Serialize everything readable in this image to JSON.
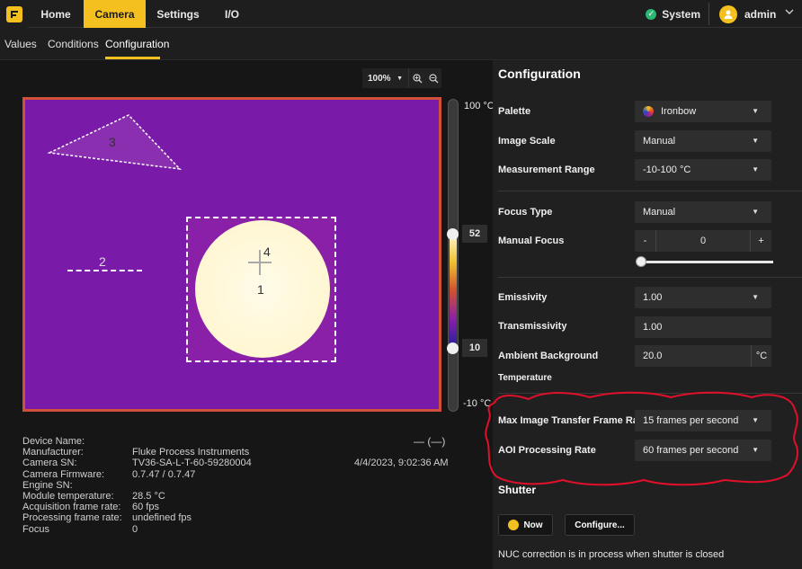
{
  "nav": {
    "tabs": [
      {
        "label": "Home"
      },
      {
        "label": "Camera"
      },
      {
        "label": "Settings"
      },
      {
        "label": "I/O"
      }
    ],
    "status_label": "System",
    "user_label": "admin"
  },
  "subtabs": [
    {
      "label": "Values"
    },
    {
      "label": "Conditions"
    },
    {
      "label": "Configuration"
    }
  ],
  "viewer": {
    "zoom_value": "100%",
    "regions": {
      "r1": "1",
      "r2": "2",
      "r3": "3",
      "r4": "4"
    },
    "scale_max_label": "100 °C",
    "scale_min_label": "-10 °C",
    "upper_value": "52",
    "lower_value": "10"
  },
  "device_info": [
    {
      "key": "Device Name:",
      "value": ""
    },
    {
      "key": "Manufacturer:",
      "value": "Fluke Process Instruments"
    },
    {
      "key": "Camera SN:",
      "value": "TV36-SA-L-T-60-59280004"
    },
    {
      "key": "Camera Firmware:",
      "value": "0.7.47 / 0.7.47"
    },
    {
      "key": "Engine SN:",
      "value": ""
    },
    {
      "key": "Module temperature:",
      "value": "28.5 °C"
    },
    {
      "key": "Acquisition frame rate:",
      "value": "60 fps"
    },
    {
      "key": "Processing frame rate:",
      "value": "undefined fps"
    },
    {
      "key": "Focus",
      "value": "0"
    }
  ],
  "minmax_text": "—  (—)",
  "timestamp": "4/4/2023, 9:02:36 AM",
  "config": {
    "title": "Configuration",
    "palette": {
      "label": "Palette",
      "value": "Ironbow"
    },
    "image_scale": {
      "label": "Image Scale",
      "value": "Manual"
    },
    "measurement_range": {
      "label": "Measurement Range",
      "value": "-10-100 °C"
    },
    "focus_type": {
      "label": "Focus Type",
      "value": "Manual"
    },
    "manual_focus": {
      "label": "Manual Focus",
      "minus": "-",
      "value": "0",
      "plus": "+",
      "slider_fraction": 0.0
    },
    "emissivity": {
      "label": "Emissivity",
      "value": "1.00"
    },
    "transmissivity": {
      "label": "Transmissivity",
      "value": "1.00"
    },
    "ambient": {
      "label": "Ambient Background",
      "label2": "Temperature",
      "value": "20.0",
      "unit": "°C"
    },
    "max_frame_rate": {
      "label": "Max Image Transfer Frame Rate",
      "value": "15 frames per second"
    },
    "aoi_rate": {
      "label": "AOI Processing Rate",
      "value": "60 frames per second"
    },
    "shutter": {
      "title": "Shutter",
      "now_label": "Now",
      "configure_label": "Configure...",
      "note": "NUC correction is in process when shutter is closed"
    }
  },
  "colors": {
    "accent": "#f4c020",
    "annotation": "#e0102a",
    "status_ok": "#2bb673"
  }
}
